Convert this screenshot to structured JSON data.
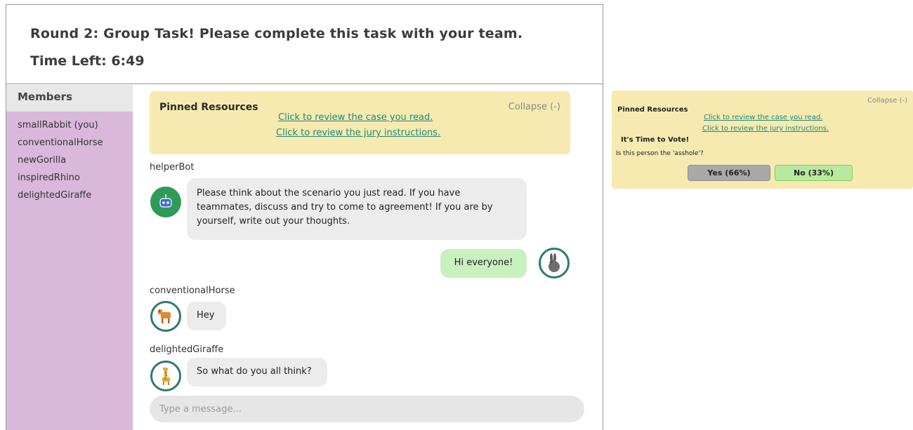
{
  "header": {
    "title": "Round 2: Group Task! Please complete this task with your team.",
    "timer": "Time Left: 6:49"
  },
  "sidebar": {
    "heading": "Members",
    "members": [
      "smallRabbit (you)",
      "conventionalHorse",
      "newGorilla",
      "inspiredRhino",
      "delightedGiraffe"
    ]
  },
  "pinned": {
    "title": "Pinned Resources",
    "collapse": "Collapse (-)",
    "link_case": "Click to review the case you read.",
    "link_jury": "Click to review the jury instructions."
  },
  "messages": [
    {
      "sender": "helperBot",
      "avatar": "robot-icon",
      "text": "Please think about the scenario you just read. If you have teammates, discuss and try to come to agreement! If you are by yourself, write out your thoughts."
    },
    {
      "sender": "smallRabbit",
      "avatar": "rabbit-icon",
      "text": "Hi everyone!",
      "mine": true
    },
    {
      "sender": "conventionalHorse",
      "avatar": "horse-icon",
      "text": "Hey"
    },
    {
      "sender": "delightedGiraffe",
      "avatar": "giraffe-icon",
      "text": "So what do you all think?"
    }
  ],
  "input": {
    "placeholder": "Type a message..."
  },
  "vote_panel": {
    "title": "Pinned Resources",
    "collapse": "Collapse (-)",
    "link_case": "Click to review the case you read.",
    "link_jury": "Click to review the jury instructions.",
    "heading": "It's Time to Vote!",
    "question": "Is this person the 'asshole'?",
    "yes_label": "Yes (66%)",
    "no_label": "No (33%)"
  },
  "colors": {
    "sidebar": "#d9b8dc",
    "pinned_bg": "#f6eab0",
    "link": "#1c8a7a",
    "my_bubble": "#c9f0bf",
    "bubble": "#ececec",
    "avatar_ring": "#2f7a70",
    "yes_button": "#a9a9a9",
    "no_button": "#b7ea9f"
  }
}
